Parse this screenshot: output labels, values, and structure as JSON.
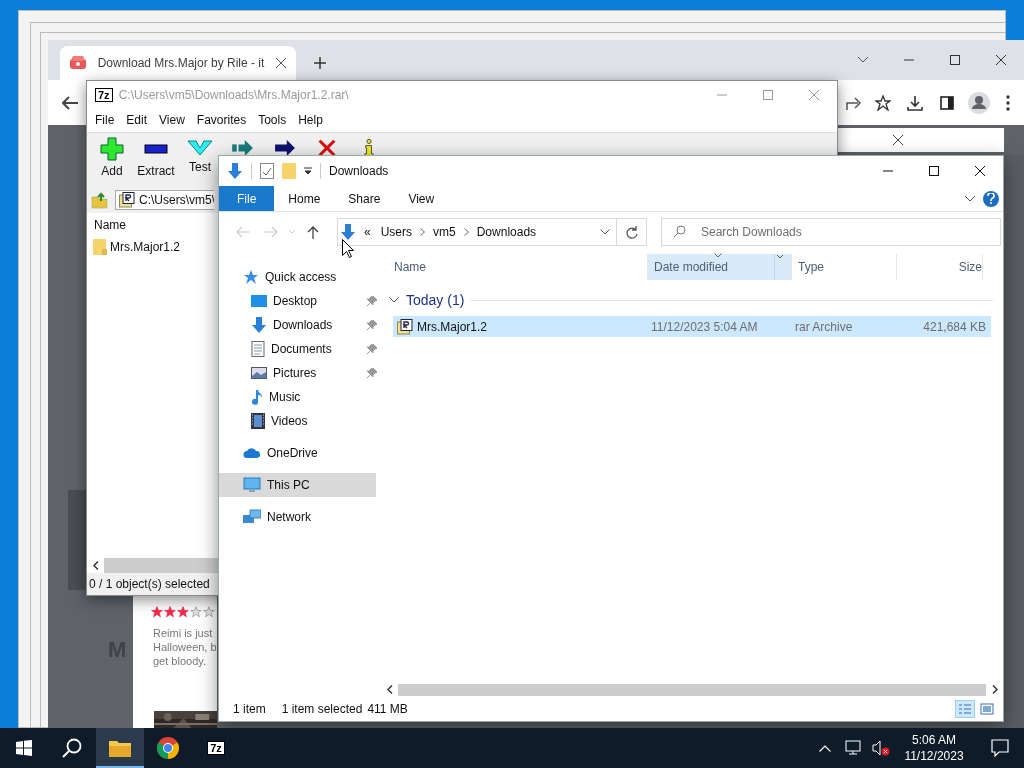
{
  "browser": {
    "tab_title": "Download Mrs.Major by Rile - it",
    "page": {
      "heading": "M",
      "card": {
        "stars": 3,
        "description_lines": [
          "Reimi is just",
          "Halloween, b",
          "get bloody."
        ]
      }
    }
  },
  "archiver": {
    "logo": "7z",
    "title": "C:\\Users\\vm5\\Downloads\\Mrs.Major1.2.rar\\",
    "menu": [
      "File",
      "Edit",
      "View",
      "Favorites",
      "Tools",
      "Help"
    ],
    "toolbar": [
      {
        "kind": "add",
        "label": "Add"
      },
      {
        "kind": "extract",
        "label": "Extract"
      },
      {
        "kind": "test",
        "label": "Test"
      },
      {
        "kind": "copy"
      },
      {
        "kind": "move"
      },
      {
        "kind": "delete"
      },
      {
        "kind": "info"
      }
    ],
    "path": "C:\\Users\\vm5\\",
    "columns": [
      "Name"
    ],
    "items": [
      {
        "name": "Mrs.Major1.2"
      }
    ],
    "status": "0 / 1 object(s) selected"
  },
  "explorer": {
    "title": "Downloads",
    "ribbon_tabs": [
      {
        "label": "File",
        "selected": true
      },
      {
        "label": "Home",
        "selected": false
      },
      {
        "label": "Share",
        "selected": false
      },
      {
        "label": "View",
        "selected": false
      }
    ],
    "breadcrumb_overflow": "«",
    "breadcrumb": [
      "Users",
      "vm5",
      "Downloads"
    ],
    "search": {
      "placeholder": "Search Downloads"
    },
    "nav": [
      {
        "label": "Quick access",
        "kind": "quick-access",
        "selected": false,
        "children": [
          {
            "label": "Desktop",
            "kind": "desktop",
            "pinned": true,
            "selected": false
          },
          {
            "label": "Downloads",
            "kind": "downloads",
            "pinned": true,
            "selected": false
          },
          {
            "label": "Documents",
            "kind": "documents",
            "pinned": true,
            "selected": false
          },
          {
            "label": "Pictures",
            "kind": "pictures",
            "pinned": true,
            "selected": false
          },
          {
            "label": "Music",
            "kind": "music",
            "pinned": false,
            "selected": false
          },
          {
            "label": "Videos",
            "kind": "videos",
            "pinned": false,
            "selected": false
          }
        ]
      },
      {
        "label": "OneDrive",
        "kind": "onedrive",
        "selected": false
      },
      {
        "label": "This PC",
        "kind": "pc",
        "selected": true
      },
      {
        "label": "Network",
        "kind": "network",
        "selected": false
      }
    ],
    "columns": [
      {
        "label": "Name",
        "sorted": false
      },
      {
        "label": "Date modified",
        "sorted": true
      },
      {
        "label": "Type",
        "sorted": false
      },
      {
        "label": "Size",
        "sorted": false
      }
    ],
    "groups": [
      {
        "label": "Today (1)",
        "expanded": true,
        "rows": [
          {
            "name": "Mrs.Major1.2",
            "date": "11/12/2023 5:04 AM",
            "type": "rar Archive",
            "size": "421,684 KB",
            "selected": true
          }
        ]
      }
    ],
    "status": {
      "count": "1 item",
      "selection": "1 item selected",
      "selection_size": "411 MB"
    },
    "view_modes": [
      {
        "kind": "details",
        "selected": true
      },
      {
        "kind": "large-icons",
        "selected": false
      }
    ]
  },
  "taskbar": {
    "buttons": [
      {
        "kind": "start"
      },
      {
        "kind": "search"
      }
    ],
    "apps": [
      {
        "kind": "explorer",
        "selected": true
      },
      {
        "kind": "chrome",
        "selected": false
      },
      {
        "kind": "sevenzip",
        "label": "7z",
        "selected": false
      }
    ],
    "tray": {
      "time": "5:06 AM",
      "date": "11/12/2023",
      "volume_muted": true
    }
  }
}
